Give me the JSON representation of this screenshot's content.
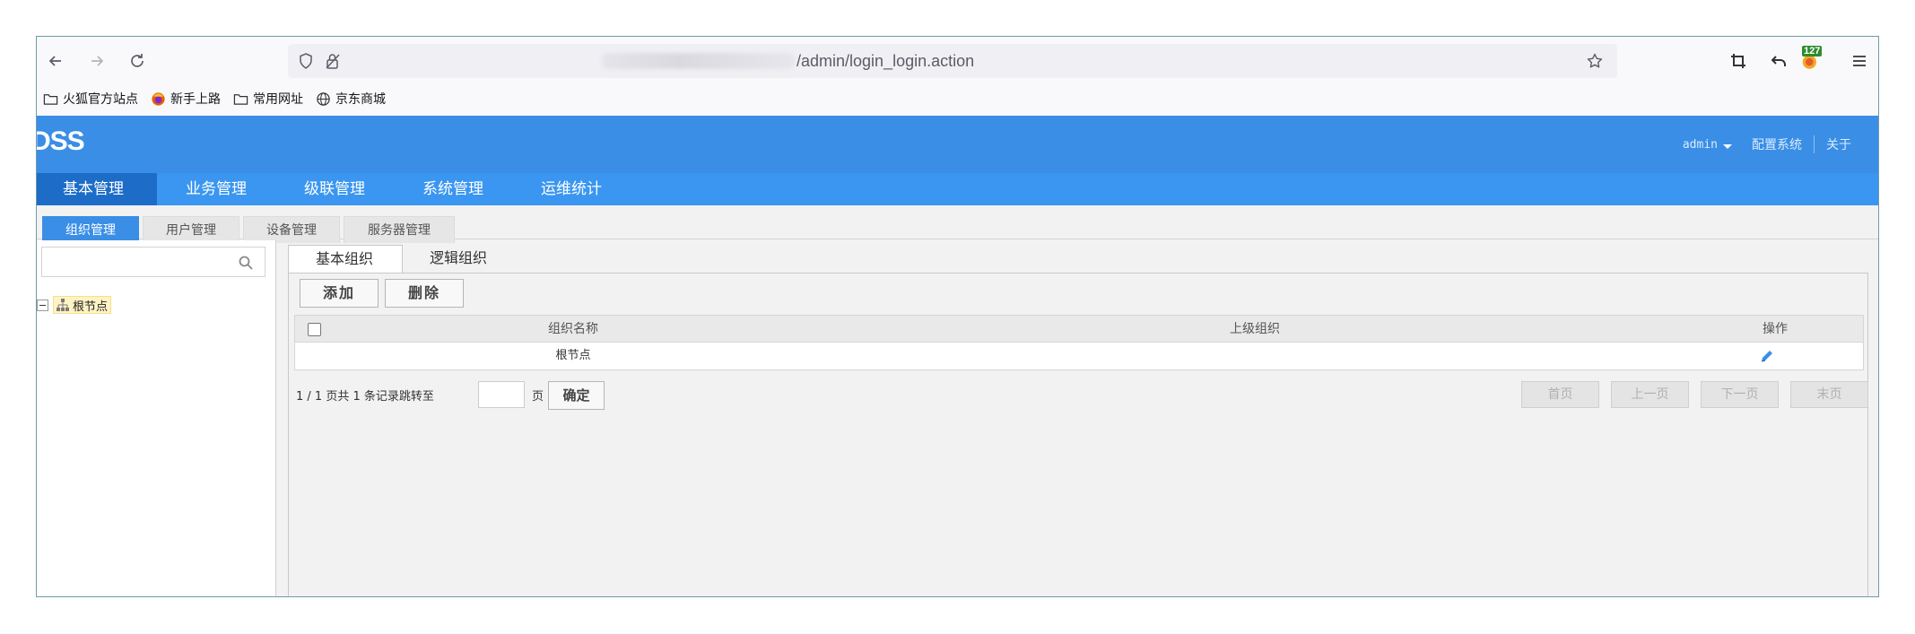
{
  "browser": {
    "url_path": "/admin/login_login.action",
    "extension_badge": "127",
    "bookmarks": [
      {
        "label": "火狐官方站点",
        "icon": "folder-icon"
      },
      {
        "label": "新手上路",
        "icon": "firefox-icon"
      },
      {
        "label": "常用网址",
        "icon": "folder-icon"
      },
      {
        "label": "京东商城",
        "icon": "globe-icon"
      }
    ]
  },
  "app": {
    "logo": "DSS",
    "user": "admin",
    "links": [
      "配置系统",
      "关于"
    ],
    "main_nav": [
      "基本管理",
      "业务管理",
      "级联管理",
      "系统管理",
      "运维统计"
    ],
    "sub_nav": [
      "组织管理",
      "用户管理",
      "设备管理",
      "服务器管理"
    ],
    "tree": {
      "root": "根节点"
    },
    "tabs": [
      "基本组织",
      "逻辑组织"
    ],
    "buttons": {
      "add": "添加",
      "delete": "删除"
    },
    "grid": {
      "headers": [
        "组织名称",
        "上级组织",
        "操作"
      ],
      "rows": [
        {
          "name": "根节点",
          "parent": ""
        }
      ]
    },
    "pager": {
      "info": "1 / 1 页共 1 条记录跳转至",
      "page_suffix": "页",
      "confirm": "确定",
      "first": "首页",
      "prev": "上一页",
      "next": "下一页",
      "last": "末页"
    }
  }
}
